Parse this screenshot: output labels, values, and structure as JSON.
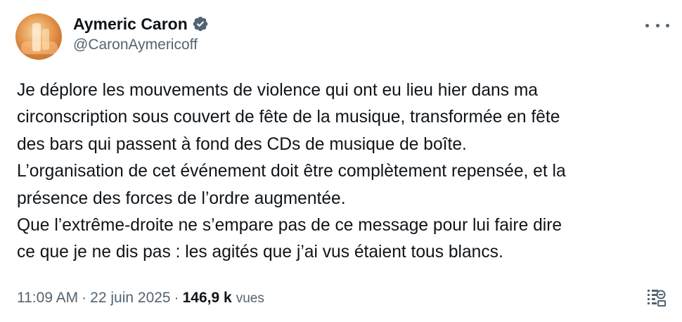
{
  "author": {
    "name": "Aymeric Caron",
    "handle": "@CaronAymericoff",
    "verified_color": "#536471"
  },
  "tweet": {
    "lines": [
      "Je déplore les mouvements de violence qui ont eu lieu hier dans ma",
      "circonscription sous couvert de fête de la musique, transformée en fête",
      "des bars qui passent à fond des CDs de musique de boîte.",
      "L’organisation de cet événement doit être complètement repensée, et la",
      "présence des forces de l’ordre augmentée.",
      "Que l’extrême-droite ne s’empare pas de ce message pour lui faire dire",
      "ce que je ne dis pas : les agités que j’ai vus étaient tous blancs."
    ],
    "time": "11:09 AM",
    "separator": "·",
    "date": "22 juin 2025",
    "views_count": "146,9 k",
    "views_label": "vues"
  },
  "icons": {
    "more": "more-options-icon",
    "verified": "verified-badge-icon",
    "analytics": "analytics-icon"
  }
}
